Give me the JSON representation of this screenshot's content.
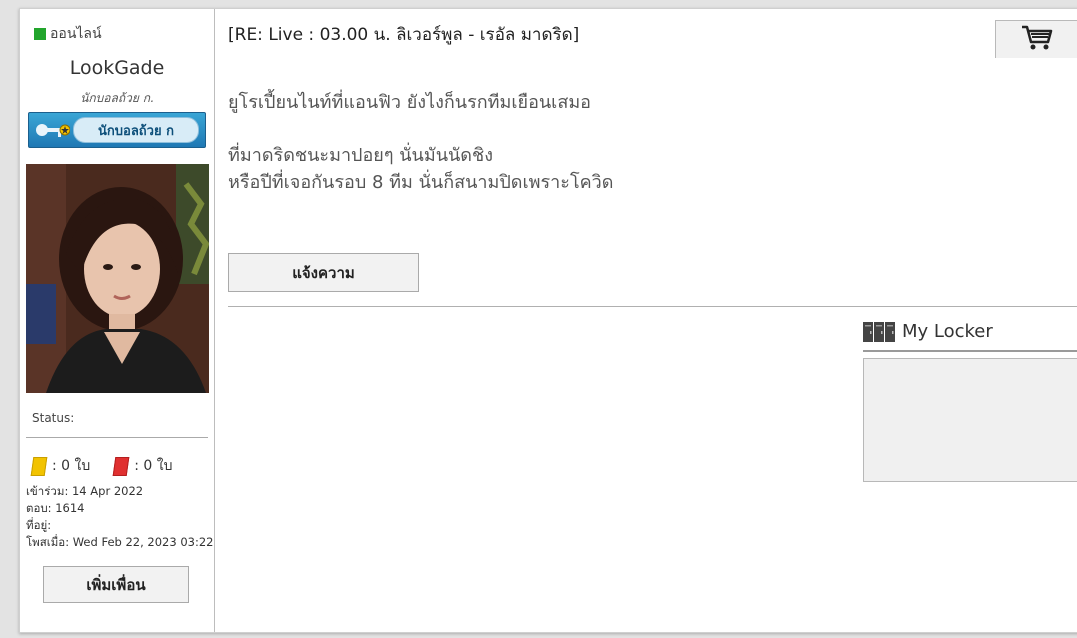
{
  "profile": {
    "online_label": "ออนไลน์",
    "username": "LookGade",
    "rank": "นักบอลถ้วย ก.",
    "badge_text": "นักบอลถ้วย ก",
    "status_label": "Status:",
    "yellow_cards": ": 0 ใบ",
    "red_cards": ": 0 ใบ",
    "joined": "เข้าร่วม: 14 Apr 2022",
    "replies": "ตอบ: 1614",
    "location": "ที่อยู่:",
    "posted": "โพสเมื่อ: Wed Feb 22, 2023 03:22",
    "add_friend_label": "เพิ่มเพื่อน"
  },
  "post": {
    "title": "[RE: Live : 03.00 น. ลิเวอร์พูล - เรอัล มาดริด]",
    "line1": "ยูโรเปี้ยนไนท์ที่แอนฟิว ยังไงก็นรกทีมเยือนเสมอ",
    "line2": "ที่มาดริดชนะมาปอยๆ นั่นมันนัดชิง",
    "line3": "หรือปีที่เจอกันรอบ 8 ทีม นั่นก็สนามปิดเพราะโควิด",
    "report_label": "แจ้งความ"
  },
  "locker": {
    "title": "My Locker"
  },
  "icons": {
    "cart": "cart-icon",
    "locker": "locker-icon",
    "online": "online-status-icon"
  },
  "colors": {
    "online": "#22a52c",
    "yellow_card": "#f2c300",
    "red_card": "#e03030",
    "badge": "#1f78b4"
  }
}
